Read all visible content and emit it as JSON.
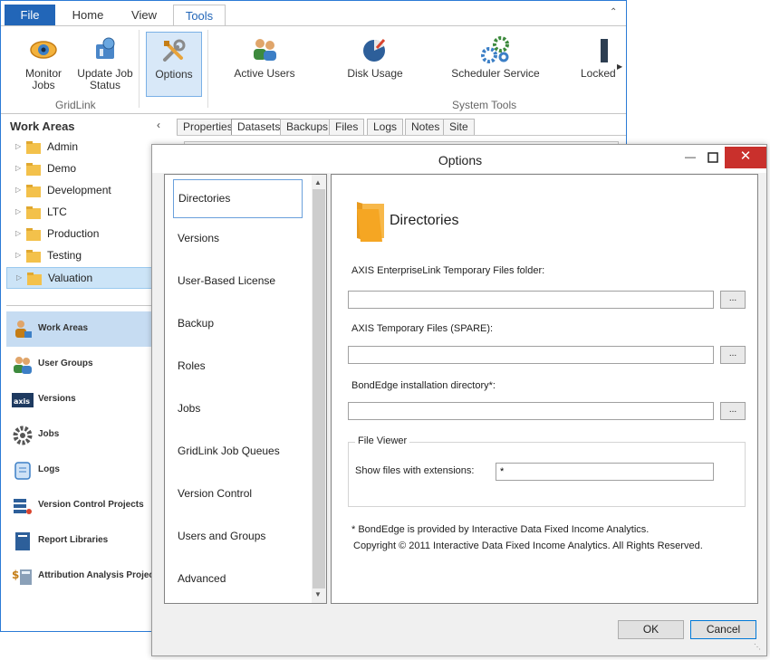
{
  "ribbon_tabs": [
    "File",
    "Home",
    "View",
    "Tools"
  ],
  "ribbon": {
    "monitor_jobs": "Monitor Jobs",
    "update_job_status": "Update Job Status",
    "options": "Options",
    "active_users": "Active Users",
    "disk_usage": "Disk Usage",
    "scheduler_service": "Scheduler Service",
    "locked": "Locked",
    "group_gridlink": "GridLink",
    "group_system_tools": "System Tools"
  },
  "work_areas": {
    "title": "Work Areas",
    "items": [
      "Admin",
      "Demo",
      "Development",
      "LTC",
      "Production",
      "Testing",
      "Valuation"
    ],
    "selected": "Valuation"
  },
  "nav": [
    "Work Areas",
    "User Groups",
    "Versions",
    "Jobs",
    "Logs",
    "Version Control Projects",
    "Report Libraries",
    "Attribution Analysis Projects"
  ],
  "doc_tabs": [
    "Properties",
    "Datasets",
    "Backups",
    "Files",
    "Logs",
    "Notes",
    "Site"
  ],
  "dialog": {
    "title": "Options",
    "nav_items": [
      "Directories",
      "Versions",
      "User-Based License",
      "Backup",
      "Roles",
      "Jobs",
      "GridLink Job Queues",
      "Version Control",
      "Users and Groups",
      "Advanced"
    ],
    "content_title": "Directories",
    "field1_label": "AXIS EnterpriseLink Temporary Files folder:",
    "field1_value": "",
    "field2_label": "AXIS Temporary Files (SPARE):",
    "field2_value": "",
    "field3_label": "BondEdge installation directory*:",
    "field3_value": "",
    "browse_label": "...",
    "file_viewer_legend": "File Viewer",
    "extensions_label": "Show files with extensions:",
    "extensions_value": "*",
    "note1": "* BondEdge is provided by Interactive Data Fixed Income Analytics.",
    "note2": "Copyright © 2011 Interactive Data Fixed Income Analytics. All Rights Reserved.",
    "ok": "OK",
    "cancel": "Cancel"
  },
  "colors": {
    "accent": "#2266b8",
    "close": "#c9302c",
    "selection": "#cce4f7"
  }
}
